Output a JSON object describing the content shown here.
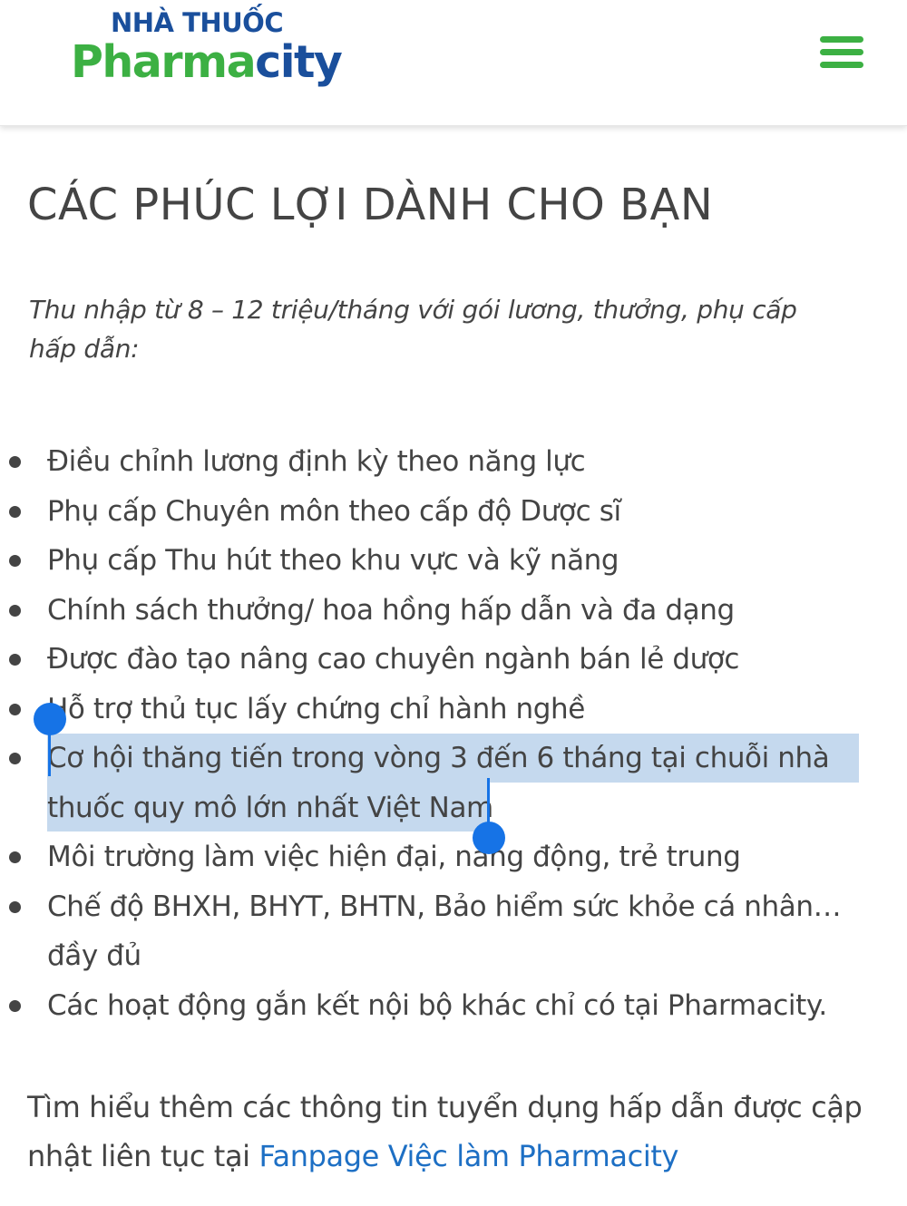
{
  "header": {
    "logo_top": "NHÀ THUỐC",
    "logo_pharma": "Pharma",
    "logo_city": "city",
    "menu_icon": "hamburger-menu-icon"
  },
  "main": {
    "title": "CÁC PHÚC LỢI DÀNH CHO BẠN",
    "intro": "Thu nhập từ 8 – 12 triệu/tháng với gói lương, thưởng, phụ cấp hấp dẫn:",
    "benefits": [
      "Điều chỉnh lương định kỳ theo năng lực",
      "Phụ cấp Chuyên môn theo cấp độ Dược sĩ",
      "Phụ cấp Thu hút theo khu vực và kỹ năng",
      "Chính sách thưởng/ hoa hồng hấp dẫn và đa dạng",
      "Được đào tạo nâng cao chuyên ngành bán lẻ dược",
      "Hỗ trợ thủ tục lấy chứng chỉ hành nghề",
      "Cơ hội thăng tiến trong vòng 3 đến 6 tháng tại chuỗi nhà thuốc quy mô lớn nhất Việt Nam",
      "Môi trường làm việc hiện đại, năng động, trẻ trung",
      "Chế độ BHXH, BHYT, BHTN, Bảo hiểm sức khỏe cá nhân… đầy đủ",
      "Các hoạt động gắn kết nội bộ khác chỉ có tại Pharmacity."
    ],
    "footer_prefix": "Tìm hiểu thêm các thông tin tuyển dụng hấp dẫn được cập nhật liên tục tại ",
    "footer_link": "Fanpage Việc làm Pharmacity"
  },
  "colors": {
    "brand_green": "#3cb043",
    "brand_blue": "#1a4f9c",
    "link_blue": "#1d6fc4",
    "selection_bg": "#c5d9ee",
    "selection_handle": "#1673e6"
  }
}
